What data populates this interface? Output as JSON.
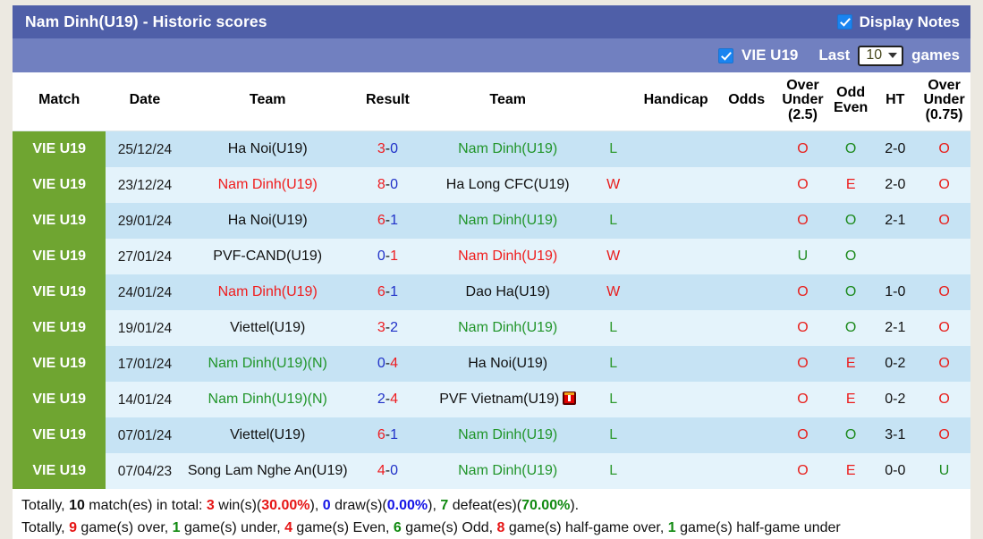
{
  "header": {
    "title": "Nam Dinh(U19) - Historic scores",
    "display_notes_label": "Display Notes",
    "display_notes_checked": true,
    "league_label": "VIE U19",
    "league_checked": true,
    "last_label": "Last",
    "games_count": "10",
    "games_label": "games",
    "bg_top": "#4f5fa8",
    "bg_sub": "#7180c0"
  },
  "columns": [
    "Match",
    "Date",
    "Team",
    "Result",
    "Team",
    "",
    "Handicap",
    "Odds",
    "Over\nUnder\n(2.5)",
    "Odd\nEven",
    "HT",
    "Over\nUnder\n(0.75)"
  ],
  "col_headers": {
    "match": "Match",
    "date": "Date",
    "team_home": "Team",
    "result": "Result",
    "team_away": "Team",
    "handicap": "Handicap",
    "odds": "Odds",
    "over_under_25_l1": "Over",
    "over_under_25_l2": "Under",
    "over_under_25_l3": "(2.5)",
    "odd_even_l1": "Odd",
    "odd_even_l2": "Even",
    "ht": "HT",
    "over_under_075_l1": "Over",
    "over_under_075_l2": "Under",
    "over_under_075_l3": "(0.75)"
  },
  "rows": [
    {
      "match": "VIE U19",
      "date": "25/12/24",
      "home": "Ha Noi(U19)",
      "home_color": "black",
      "score_home": "3",
      "score_away": "0",
      "score_home_color": "red",
      "score_away_color": "blue",
      "away": "Nam Dinh(U19)",
      "away_color": "green",
      "away_card": false,
      "wl": "L",
      "wl_type": "L",
      "handicap": "",
      "odds": "",
      "ou25": "O",
      "ou25_type": "O",
      "oe": "O",
      "oe_type": "O",
      "ht": "2-0",
      "ou075": "O",
      "ou075_type": "O"
    },
    {
      "match": "VIE U19",
      "date": "23/12/24",
      "home": "Nam Dinh(U19)",
      "home_color": "red",
      "score_home": "8",
      "score_away": "0",
      "score_home_color": "red",
      "score_away_color": "blue",
      "away": "Ha Long CFC(U19)",
      "away_color": "black",
      "away_card": false,
      "wl": "W",
      "wl_type": "W",
      "handicap": "",
      "odds": "",
      "ou25": "O",
      "ou25_type": "O",
      "oe": "E",
      "oe_type": "E",
      "ht": "2-0",
      "ou075": "O",
      "ou075_type": "O"
    },
    {
      "match": "VIE U19",
      "date": "29/01/24",
      "home": "Ha Noi(U19)",
      "home_color": "black",
      "score_home": "6",
      "score_away": "1",
      "score_home_color": "red",
      "score_away_color": "blue",
      "away": "Nam Dinh(U19)",
      "away_color": "green",
      "away_card": false,
      "wl": "L",
      "wl_type": "L",
      "handicap": "",
      "odds": "",
      "ou25": "O",
      "ou25_type": "O",
      "oe": "O",
      "oe_type": "O",
      "ht": "2-1",
      "ou075": "O",
      "ou075_type": "O"
    },
    {
      "match": "VIE U19",
      "date": "27/01/24",
      "home": "PVF-CAND(U19)",
      "home_color": "black",
      "score_home": "0",
      "score_away": "1",
      "score_home_color": "blue",
      "score_away_color": "red",
      "away": "Nam Dinh(U19)",
      "away_color": "red",
      "away_card": false,
      "wl": "W",
      "wl_type": "W",
      "handicap": "",
      "odds": "",
      "ou25": "U",
      "ou25_type": "U",
      "oe": "O",
      "oe_type": "O",
      "ht": "",
      "ou075": "",
      "ou075_type": ""
    },
    {
      "match": "VIE U19",
      "date": "24/01/24",
      "home": "Nam Dinh(U19)",
      "home_color": "red",
      "score_home": "6",
      "score_away": "1",
      "score_home_color": "red",
      "score_away_color": "blue",
      "away": "Dao Ha(U19)",
      "away_color": "black",
      "away_card": false,
      "wl": "W",
      "wl_type": "W",
      "handicap": "",
      "odds": "",
      "ou25": "O",
      "ou25_type": "O",
      "oe": "O",
      "oe_type": "O",
      "ht": "1-0",
      "ou075": "O",
      "ou075_type": "O"
    },
    {
      "match": "VIE U19",
      "date": "19/01/24",
      "home": "Viettel(U19)",
      "home_color": "black",
      "score_home": "3",
      "score_away": "2",
      "score_home_color": "red",
      "score_away_color": "blue",
      "away": "Nam Dinh(U19)",
      "away_color": "green",
      "away_card": false,
      "wl": "L",
      "wl_type": "L",
      "handicap": "",
      "odds": "",
      "ou25": "O",
      "ou25_type": "O",
      "oe": "O",
      "oe_type": "O",
      "ht": "2-1",
      "ou075": "O",
      "ou075_type": "O"
    },
    {
      "match": "VIE U19",
      "date": "17/01/24",
      "home": "Nam Dinh(U19)(N)",
      "home_color": "green",
      "score_home": "0",
      "score_away": "4",
      "score_home_color": "blue",
      "score_away_color": "red",
      "away": "Ha Noi(U19)",
      "away_color": "black",
      "away_card": false,
      "wl": "L",
      "wl_type": "L",
      "handicap": "",
      "odds": "",
      "ou25": "O",
      "ou25_type": "O",
      "oe": "E",
      "oe_type": "E",
      "ht": "0-2",
      "ou075": "O",
      "ou075_type": "O"
    },
    {
      "match": "VIE U19",
      "date": "14/01/24",
      "home": "Nam Dinh(U19)(N)",
      "home_color": "green",
      "score_home": "2",
      "score_away": "4",
      "score_home_color": "blue",
      "score_away_color": "red",
      "away": "PVF Vietnam(U19)",
      "away_color": "black",
      "away_card": true,
      "wl": "L",
      "wl_type": "L",
      "handicap": "",
      "odds": "",
      "ou25": "O",
      "ou25_type": "O",
      "oe": "E",
      "oe_type": "E",
      "ht": "0-2",
      "ou075": "O",
      "ou075_type": "O"
    },
    {
      "match": "VIE U19",
      "date": "07/01/24",
      "home": "Viettel(U19)",
      "home_color": "black",
      "score_home": "6",
      "score_away": "1",
      "score_home_color": "red",
      "score_away_color": "blue",
      "away": "Nam Dinh(U19)",
      "away_color": "green",
      "away_card": false,
      "wl": "L",
      "wl_type": "L",
      "handicap": "",
      "odds": "",
      "ou25": "O",
      "ou25_type": "O",
      "oe": "O",
      "oe_type": "O",
      "ht": "3-1",
      "ou075": "O",
      "ou075_type": "O"
    },
    {
      "match": "VIE U19",
      "date": "07/04/23",
      "home": "Song Lam Nghe An(U19)",
      "home_color": "black",
      "score_home": "4",
      "score_away": "0",
      "score_home_color": "red",
      "score_away_color": "blue",
      "away": "Nam Dinh(U19)",
      "away_color": "green",
      "away_card": false,
      "wl": "L",
      "wl_type": "L",
      "handicap": "",
      "odds": "",
      "ou25": "O",
      "ou25_type": "O",
      "oe": "E",
      "oe_type": "E",
      "ht": "0-0",
      "ou075": "U",
      "ou075_type": "U"
    }
  ],
  "footer": {
    "line1": [
      {
        "t": "Totally, ",
        "c": "plain"
      },
      {
        "t": "10",
        "c": "bold"
      },
      {
        "t": " match(es) in total: ",
        "c": "plain"
      },
      {
        "t": "3",
        "c": "red"
      },
      {
        "t": " win(s)(",
        "c": "plain"
      },
      {
        "t": "30.00%",
        "c": "red"
      },
      {
        "t": "), ",
        "c": "plain"
      },
      {
        "t": "0",
        "c": "blue"
      },
      {
        "t": " draw(s)(",
        "c": "plain"
      },
      {
        "t": "0.00%",
        "c": "blue"
      },
      {
        "t": "), ",
        "c": "plain"
      },
      {
        "t": "7",
        "c": "green"
      },
      {
        "t": " defeat(es)(",
        "c": "plain"
      },
      {
        "t": "70.00%",
        "c": "green"
      },
      {
        "t": ").",
        "c": "plain"
      }
    ],
    "line2": [
      {
        "t": "Totally, ",
        "c": "plain"
      },
      {
        "t": "9",
        "c": "red"
      },
      {
        "t": " game(s) over, ",
        "c": "plain"
      },
      {
        "t": "1",
        "c": "green"
      },
      {
        "t": " game(s) under, ",
        "c": "plain"
      },
      {
        "t": "4",
        "c": "red"
      },
      {
        "t": " game(s) Even, ",
        "c": "plain"
      },
      {
        "t": "6",
        "c": "green"
      },
      {
        "t": " game(s) Odd, ",
        "c": "plain"
      },
      {
        "t": "8",
        "c": "red"
      },
      {
        "t": " game(s) half-game over, ",
        "c": "plain"
      },
      {
        "t": "1",
        "c": "green"
      },
      {
        "t": " game(s) half-game under",
        "c": "plain"
      }
    ]
  }
}
